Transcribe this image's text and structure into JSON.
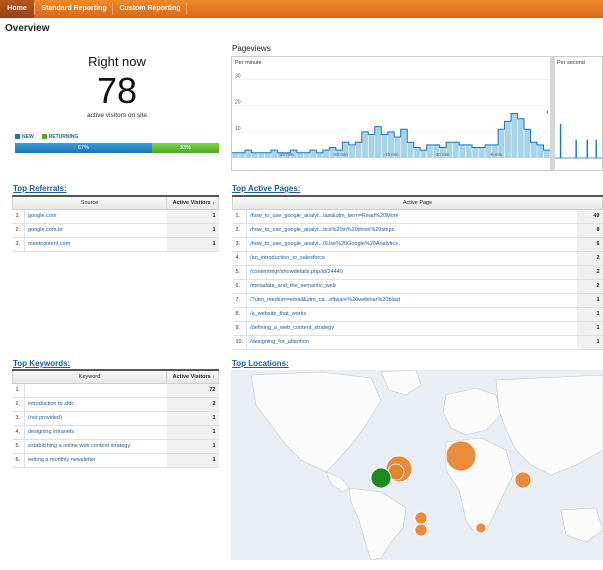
{
  "nav": {
    "tabs": [
      {
        "label": "Home"
      },
      {
        "label": "Standard Reporting"
      },
      {
        "label": "Custom Reporting"
      }
    ]
  },
  "page_title": "Overview",
  "right_now": {
    "title": "Right now",
    "count": "78",
    "subtitle": "active visitors on site",
    "legend_new": "NEW",
    "legend_returning": "RETURNING",
    "new_percent": "67%",
    "returning_percent": "33%",
    "new_fraction": 0.67,
    "new_color": "#1877bc",
    "returning_color": "#4fa924"
  },
  "pageviews": {
    "title": "Pageviews",
    "per_minute_label": "Per minute",
    "per_second_label": "Per second",
    "y_ticks": [
      "30",
      "20",
      "10"
    ],
    "x_ticks": [
      "-25 min",
      "-20 min",
      "-15 min",
      "-10 min",
      "-5 min"
    ],
    "per_minute_values": [
      2,
      2,
      3,
      2,
      2,
      2,
      3,
      2,
      2,
      3,
      2,
      2,
      3,
      2,
      3,
      4,
      3,
      6,
      5,
      6,
      10,
      9,
      12,
      9,
      10,
      8,
      11,
      6,
      4,
      3,
      5,
      5,
      4,
      6,
      6,
      5,
      5,
      4,
      4,
      5,
      5,
      11,
      14,
      17,
      15,
      11,
      6,
      5,
      3
    ],
    "per_second_values": [
      0,
      0,
      13,
      0,
      0,
      0,
      0,
      0,
      0,
      7,
      0,
      0,
      0,
      0,
      7,
      0,
      0,
      0,
      7,
      0,
      0,
      3
    ],
    "bar_color": "#a8d4ea",
    "line_color": "#1877bc"
  },
  "referrals": {
    "title": "Top Referrals:",
    "col_source": "Source",
    "col_visitors": "Active Visitors ↓",
    "rows": [
      {
        "idx": "1.",
        "label": "google.com",
        "value": "1"
      },
      {
        "idx": "2.",
        "label": "google.com.br",
        "value": "1"
      },
      {
        "idx": "3.",
        "label": "meetcontent.com",
        "value": "1"
      }
    ]
  },
  "active_pages": {
    "title": "Top Active Pages:",
    "col_page": "Active Page",
    "rows": [
      {
        "idx": "1.",
        "label": "/how_to_use_google_analyt...last&utm_term=Read%20More",
        "value": "49"
      },
      {
        "idx": "2.",
        "label": "/how_to_use_google_analyt...tics%20in%20three%20steps",
        "value": "8"
      },
      {
        "idx": "3.",
        "label": "/how_to_use_google_analyt...0Use%20Google%20Analytics",
        "value": "6"
      },
      {
        "idx": "4.",
        "label": "/an_introduction_to_salesforce",
        "value": "2"
      },
      {
        "idx": "5.",
        "label": "/contentmgr/showdetails.php/id/24449",
        "value": "2"
      },
      {
        "idx": "6.",
        "label": "/metadata_and_the_semantic_web",
        "value": "2"
      },
      {
        "idx": "7.",
        "label": "/?utm_medium=email&utm_ca...oftware%20webinar%20blast",
        "value": "1"
      },
      {
        "idx": "8.",
        "label": "/a_website_that_works",
        "value": "1"
      },
      {
        "idx": "9.",
        "label": "/defining_a_web_content_strategy",
        "value": "1"
      },
      {
        "idx": "10.",
        "label": "/designing_for_attention",
        "value": "1"
      }
    ]
  },
  "keywords": {
    "title": "Top Keywords:",
    "col_keyword": "Keyword",
    "col_visitors": "Active Visitors ↓",
    "rows": [
      {
        "idx": "1.",
        "label": "",
        "value": "72"
      },
      {
        "idx": "2.",
        "label": "introduction to sfdc",
        "value": "2"
      },
      {
        "idx": "3.",
        "label": "(not provided)",
        "value": "1"
      },
      {
        "idx": "4.",
        "label": "designing intranets",
        "value": "1"
      },
      {
        "idx": "5.",
        "label": "establishing a online web content strategy",
        "value": "1"
      },
      {
        "idx": "6.",
        "label": "writing a monthly newsletter",
        "value": "1"
      }
    ]
  },
  "locations": {
    "title": "Top Locations:",
    "bubble_color": "#e8822a",
    "green_color": "#1d8a1d"
  }
}
